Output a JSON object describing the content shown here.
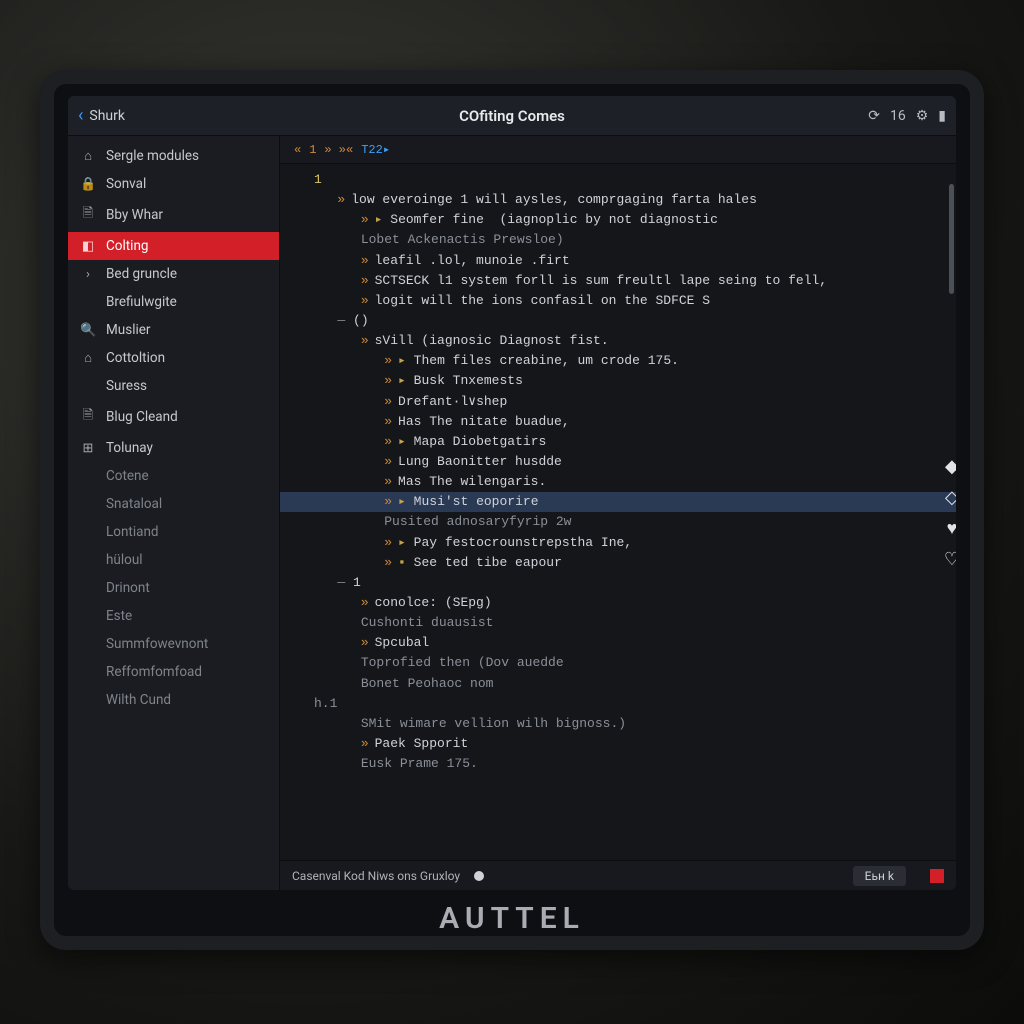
{
  "device_brand": "AUTTEL",
  "topbar": {
    "back_label": "Shurk",
    "title": "COfiting Comes",
    "clock": "16",
    "clock_icon": "⟳",
    "gear_icon": "⚙",
    "batt_icon": "▮"
  },
  "sidebar": {
    "items": [
      {
        "icon": "⌂",
        "label": "Sergle modules"
      },
      {
        "icon": "🔒",
        "label": "Sonval"
      },
      {
        "icon": "🗎",
        "label": "Bby Whar"
      },
      {
        "icon": "◧",
        "label": "Colting",
        "active": true
      },
      {
        "icon": "›",
        "label": "Bed gruncle"
      },
      {
        "icon": "",
        "label": "Brefiulwgite"
      },
      {
        "icon": "🔍",
        "label": "Muslier"
      },
      {
        "icon": "⌂",
        "label": "Cottoltion"
      },
      {
        "icon": "",
        "label": "Suress"
      },
      {
        "icon": "🗎",
        "label": "Blug Cleand"
      },
      {
        "icon": "⊞",
        "label": "Tolunay"
      },
      {
        "icon": "",
        "label": "Cotene",
        "dim": true
      },
      {
        "icon": "",
        "label": "Snataloal",
        "dim": true
      },
      {
        "icon": "",
        "label": "Lontiand",
        "dim": true
      },
      {
        "icon": "",
        "label": "hüloul",
        "dim": true
      },
      {
        "icon": "",
        "label": "Drinont",
        "dim": true
      },
      {
        "icon": "",
        "label": "Este",
        "dim": true
      },
      {
        "icon": "",
        "label": "Summfowevnont",
        "dim": true
      },
      {
        "icon": "",
        "label": "Reffomfomfoad",
        "dim": true
      },
      {
        "icon": "",
        "label": "Wilth Cund",
        "dim": true
      }
    ]
  },
  "crumb": {
    "index": "1",
    "arrows": "» »«",
    "tag": "T22▸"
  },
  "code": {
    "lines": [
      {
        "t": "1",
        "cls": "num",
        "indent": 0
      },
      {
        "t": "low everoinge 1 will aysles, comprgaging farta hales",
        "chev": true,
        "indent": 1
      },
      {
        "t": "Seomfer fine  (iagnoplic by not diagnostic",
        "chev": true,
        "folder": true,
        "indent": 2
      },
      {
        "t": "Lobet Ackenactis Prewsloe)",
        "indent": 2,
        "mute": true
      },
      {
        "t": "leafil .lol, munoie .firt",
        "chev": true,
        "indent": 2
      },
      {
        "t": "SCTSECK l1 system forll is sum freultl lape seing to fell,",
        "chev": true,
        "indent": 2
      },
      {
        "t": "logit will the ions confasil on the SDFCE S",
        "chev": true,
        "indent": 2
      },
      {
        "t": "()",
        "dash": true,
        "indent": 1
      },
      {
        "t": "sVill (iagnosic Diagnost fist.",
        "chev": true,
        "indent": 2
      },
      {
        "t": "Them files creabine, um crode 175.",
        "chev": true,
        "folder": true,
        "indent": 3
      },
      {
        "t": "Busk Tnxemests",
        "chev": true,
        "folder": true,
        "indent": 3
      },
      {
        "t": "Drefant·l∨shep",
        "chev": true,
        "indent": 3
      },
      {
        "t": "Has The nitate buadue,",
        "chev": true,
        "indent": 3
      },
      {
        "t": "Mapa Diobetgatirs",
        "chev": true,
        "folder": true,
        "indent": 3
      },
      {
        "t": "Lung Baonitter husdde",
        "chev": true,
        "indent": 3
      },
      {
        "t": "Mas The wilengaris.",
        "chev": true,
        "indent": 3
      },
      {
        "t": "Musi'st eoporire",
        "chev": true,
        "folder": true,
        "indent": 3,
        "sel": true
      },
      {
        "t": "Pusited adnosaryfyrip 2w",
        "indent": 3,
        "mute": true
      },
      {
        "t": "Pay festocrounstrepstha Ine,",
        "chev": true,
        "folder": true,
        "indent": 3
      },
      {
        "t": "See ted tibe eapour",
        "chev": true,
        "file": true,
        "indent": 3
      },
      {
        "t": "1",
        "dash": true,
        "indent": 1
      },
      {
        "t": "conolce: (SEpg)",
        "chev": true,
        "indent": 2
      },
      {
        "t": "Cushonti duausist",
        "indent": 2,
        "mute": true
      },
      {
        "t": "Spcubal",
        "chev": true,
        "indent": 2
      },
      {
        "t": "Toprofied then (Dov auedde",
        "indent": 2,
        "mute": true
      },
      {
        "t": "Bonet Peohaoc nom",
        "indent": 2,
        "mute": true
      },
      {
        "t": "h.1",
        "indent": 0,
        "mute": true
      },
      {
        "t": "SMit wimare vellion wilh bignoss.)",
        "indent": 2,
        "mute": true
      },
      {
        "t": "Paek Spporit",
        "chev": true,
        "indent": 2
      },
      {
        "t": "Eusk Prame 175.",
        "indent": 2,
        "mute": true
      }
    ]
  },
  "status": {
    "text": "Casenval  Kod Niws  ons Gruxloy",
    "button": "Еьн k"
  },
  "sideactions": [
    "◆",
    "◇",
    "♥",
    "♡"
  ]
}
